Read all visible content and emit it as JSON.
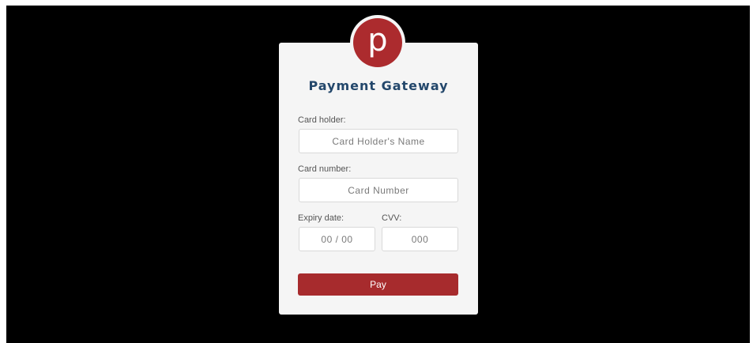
{
  "brand": {
    "logo_letter": "p",
    "title": "Payment Gateway",
    "accent_color": "#ac2b2e",
    "title_color": "#23476b"
  },
  "form": {
    "card_holder": {
      "label": "Card holder:",
      "placeholder": "Card Holder's Name",
      "value": ""
    },
    "card_number": {
      "label": "Card number:",
      "placeholder": "Card Number",
      "value": ""
    },
    "expiry": {
      "label": "Expiry date:",
      "placeholder": "00 / 00",
      "value": ""
    },
    "cvv": {
      "label": "CVV:",
      "placeholder": "000",
      "value": ""
    },
    "submit_label": "Pay"
  }
}
